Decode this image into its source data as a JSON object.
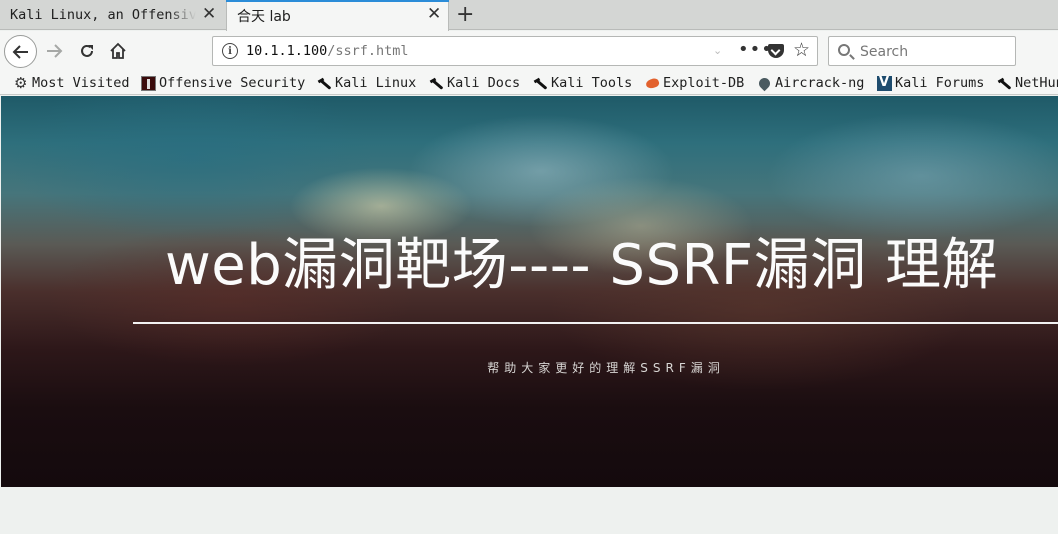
{
  "tabs": [
    {
      "title": "Kali Linux, an Offensive Security",
      "close": "✕"
    },
    {
      "title": "合天 lab",
      "close": "✕"
    }
  ],
  "new_tab_label": "+",
  "nav": {
    "back_icon": "arrow-left-icon",
    "forward_icon": "arrow-right-icon",
    "reload_icon": "reload-icon",
    "home_icon": "home-icon"
  },
  "urlbar": {
    "host": "10.1.1.100",
    "path": "/ssrf.html",
    "more_label": "•••",
    "star_label": "☆"
  },
  "search": {
    "placeholder": "Search"
  },
  "bookmarks": [
    {
      "label": "Most Visited",
      "icon": "gear-icon"
    },
    {
      "label": "Offensive Security",
      "icon": "offsec-icon"
    },
    {
      "label": "Kali Linux",
      "icon": "kali-dragon-icon"
    },
    {
      "label": "Kali Docs",
      "icon": "kali-dragon-icon"
    },
    {
      "label": "Kali Tools",
      "icon": "kali-dragon-icon"
    },
    {
      "label": "Exploit-DB",
      "icon": "exploit-db-icon"
    },
    {
      "label": "Aircrack-ng",
      "icon": "aircrack-icon"
    },
    {
      "label": "Kali Forums",
      "icon": "kali-forums-icon"
    },
    {
      "label": "NetHunter",
      "icon": "kali-dragon-icon"
    }
  ],
  "hero": {
    "title": "web漏洞靶场---- SSRF漏洞 理解",
    "subtitle": "帮助大家更好的理解SSRF漏洞"
  }
}
